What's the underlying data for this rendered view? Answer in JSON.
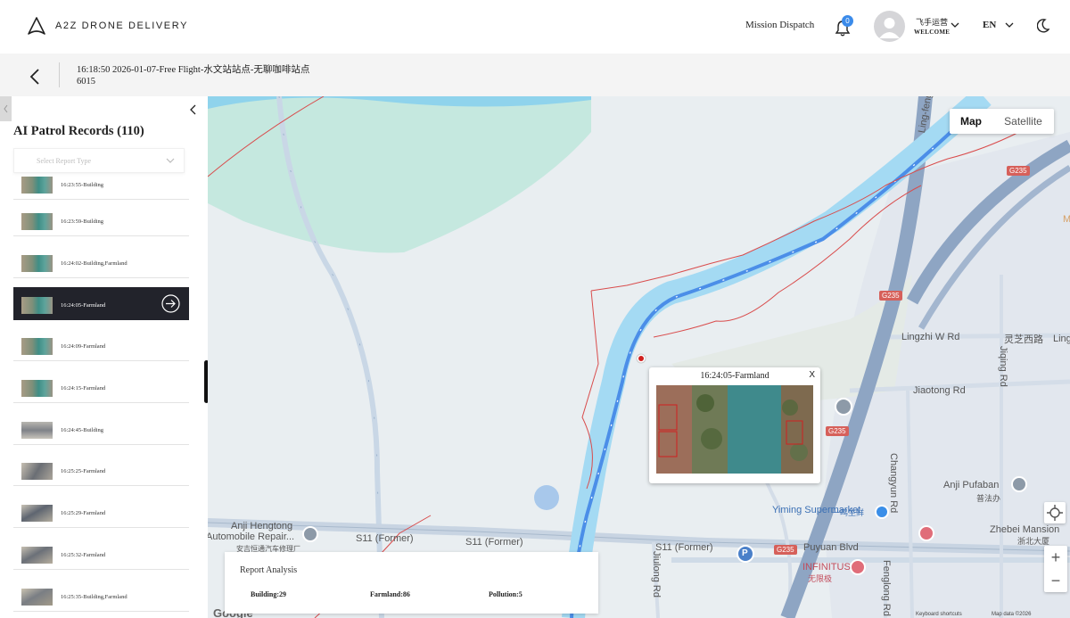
{
  "header": {
    "brand": "A2Z DRONE DELIVERY",
    "mission_dispatch": "Mission Dispatch",
    "notification_count": "0",
    "user_name": "飞手运营",
    "user_greeting": "WELCOME",
    "language": "EN"
  },
  "flight": {
    "title": "16:18:50 2026-01-07-Free Flight-水文站站点-无聊咖啡站点",
    "id": "6015"
  },
  "sidebar": {
    "title": "AI Patrol Records (110)",
    "filter_placeholder": "Select Report Type",
    "records": [
      {
        "label": "16:23:55-Building"
      },
      {
        "label": "16:23:59-Building"
      },
      {
        "label": "16:24:02-Building,Farmland"
      },
      {
        "label": "16:24:05-Farmland",
        "active": true
      },
      {
        "label": "16:24:09-Farmland"
      },
      {
        "label": "16:24:15-Farmland"
      },
      {
        "label": "16:24:45-Building"
      },
      {
        "label": "16:25:25-Farmland"
      },
      {
        "label": "16:25:29-Farmland"
      },
      {
        "label": "16:25:32-Farmland"
      },
      {
        "label": "16:25:35-Building,Farmland"
      }
    ]
  },
  "map": {
    "toggle": {
      "map": "Map",
      "satellite": "Satellite"
    },
    "labels": {
      "lingzhi_w": "Lingzhi W Rd",
      "lingzhi_cn": "灵芝西路",
      "jiaotong": "Jiaotong Rd",
      "ling_feng": "Ling-feng N Rd",
      "changyun": "Changyun Rd",
      "jiqing": "Jiqing Rd",
      "jiulong": "Jiulong Rd",
      "fenglong": "Fenglong Rd",
      "s11_a": "S11 (Former)",
      "s11_b": "S11 (Former)",
      "s11_c": "S11 (Former)",
      "puyuan": "Puyuan Blvd",
      "yiming": "Yiming Supermarket",
      "yiming_cn": "一鸣生鲜",
      "anji_hengtong": "Anji Hengtong",
      "auto_repair": "Automobile Repair...",
      "auto_repair_cn": "安吉恒通汽车修理厂",
      "anji_pufaban": "Anji Pufaban",
      "pufaban_cn": "普法办",
      "zhebei": "Zhebei Mansion",
      "zhebei_cn": "浙北大厦",
      "infinitus": "INFINITUS",
      "infinitus_cn": "无限极",
      "ling_partial": "Ling",
      "m_partial": "M",
      "parking": "P",
      "google": "Google",
      "shortcuts": "Keyboard shortcuts",
      "map_data": "Map data ©2026"
    },
    "shields": [
      "G235",
      "G235",
      "G235",
      "G235"
    ],
    "colors": {
      "route": "#4b8ee8",
      "river": "#a8d7f0",
      "boundary": "#d94c4c",
      "expressway": "#8aa2c0"
    }
  },
  "popup": {
    "title": "16:24:05-Farmland",
    "close": "X"
  },
  "report": {
    "title": "Report Analysis",
    "building": "Building:29",
    "farmland": "Farmland:86",
    "pollution": "Pollution:5"
  }
}
